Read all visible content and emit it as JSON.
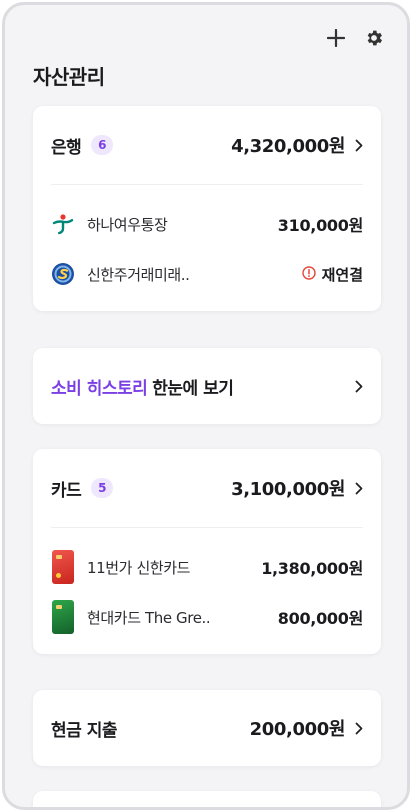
{
  "header": {
    "title": "자산관리",
    "add_icon": "plus-icon",
    "settings_icon": "gear-icon"
  },
  "bank": {
    "title": "은행",
    "count": "6",
    "total": "4,320,000원",
    "items": [
      {
        "name": "하나여우통장",
        "amount": "310,000원",
        "icon": "hana-bank-logo"
      },
      {
        "name": "신한주거래미래..",
        "status": "재연결",
        "icon": "shinhan-bank-logo"
      }
    ]
  },
  "history": {
    "highlight": "소비 히스토리",
    "rest": "한눈에 보기"
  },
  "card": {
    "title": "카드",
    "count": "5",
    "total": "3,100,000원",
    "items": [
      {
        "name": "11번가 신한카드",
        "amount": "1,380,000원",
        "icon": "red-card-icon"
      },
      {
        "name": "현대카드 The Gre..",
        "amount": "800,000원",
        "icon": "green-card-icon"
      }
    ]
  },
  "cash": {
    "title": "현금 지출",
    "total": "200,000원"
  },
  "colors": {
    "accent": "#7b3fe4",
    "badge_bg": "#efe7fd",
    "warning": "#e5483d"
  }
}
